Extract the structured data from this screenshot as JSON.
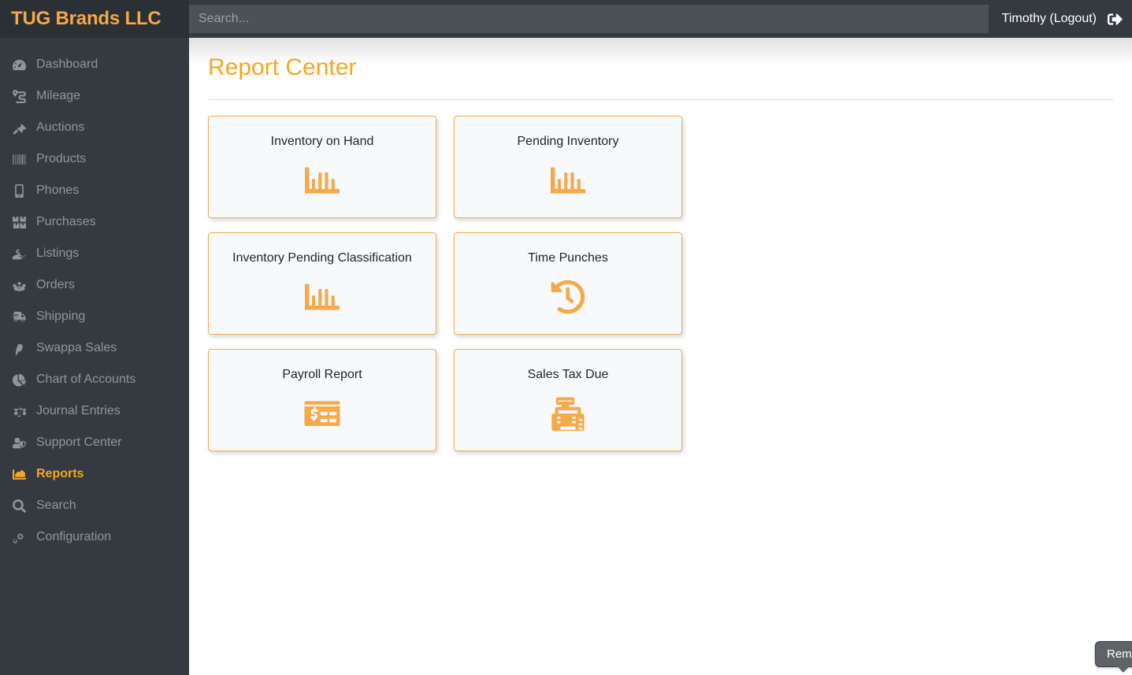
{
  "brand": {
    "name": "TUG Brands LLC"
  },
  "topbar": {
    "search_placeholder": "Search...",
    "search_value": "",
    "user_label": "Timothy (Logout)",
    "logout_icon": "sign-out-icon"
  },
  "sidebar": {
    "items": [
      {
        "label": "Dashboard",
        "icon": "tachometer-icon",
        "active": false
      },
      {
        "label": "Mileage",
        "icon": "route-icon",
        "active": false
      },
      {
        "label": "Auctions",
        "icon": "gavel-icon",
        "active": false
      },
      {
        "label": "Products",
        "icon": "barcode-icon",
        "active": false
      },
      {
        "label": "Phones",
        "icon": "mobile-icon",
        "active": false
      },
      {
        "label": "Purchases",
        "icon": "boxes-icon",
        "active": false
      },
      {
        "label": "Listings",
        "icon": "hand-holding-usd-icon",
        "active": false
      },
      {
        "label": "Orders",
        "icon": "box-open-icon",
        "active": false
      },
      {
        "label": "Shipping",
        "icon": "shipping-fast-icon",
        "active": false
      },
      {
        "label": "Swappa Sales",
        "icon": "paypal-icon",
        "active": false
      },
      {
        "label": "Chart of Accounts",
        "icon": "chart-pie-icon",
        "active": false
      },
      {
        "label": "Journal Entries",
        "icon": "balance-scale-icon",
        "active": false
      },
      {
        "label": "Support Center",
        "icon": "user-shield-icon",
        "active": false
      },
      {
        "label": "Reports",
        "icon": "chart-area-icon",
        "active": true
      },
      {
        "label": "Search",
        "icon": "search-icon",
        "active": false
      },
      {
        "label": "Configuration",
        "icon": "cogs-icon",
        "active": false
      }
    ]
  },
  "page": {
    "title": "Report Center"
  },
  "reports": [
    {
      "label": "Inventory on Hand",
      "icon": "chart-bar-icon"
    },
    {
      "label": "Pending Inventory",
      "icon": "chart-bar-icon"
    },
    {
      "label": "Inventory Pending Classification",
      "icon": "chart-bar-icon"
    },
    {
      "label": "Time Punches",
      "icon": "history-icon"
    },
    {
      "label": "Payroll Report",
      "icon": "money-check-icon"
    },
    {
      "label": "Sales Tax Due",
      "icon": "cash-register-icon"
    }
  ],
  "reminder": {
    "label": "Remi"
  },
  "colors": {
    "accent": "#f5a623",
    "card_border": "#f0ad4e",
    "sidebar_bg": "#343a40",
    "brand_bg": "#2b3035",
    "card_bg": "#f8f9fa"
  }
}
